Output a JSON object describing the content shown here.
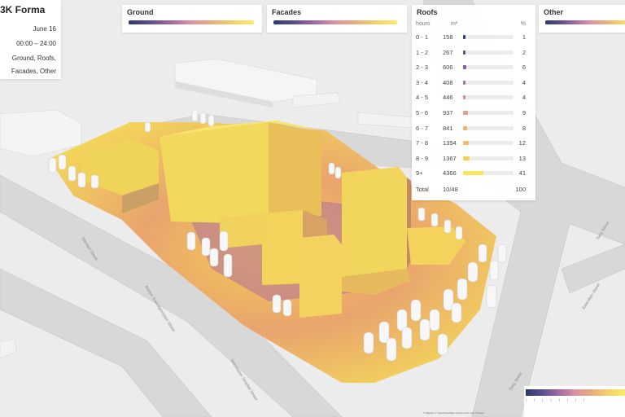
{
  "app": {
    "title": "3K Forma"
  },
  "info": {
    "date": "June 16",
    "time": "00:00 – 24:00",
    "surfaces_line1": "Ground, Roofs,",
    "surfaces_line2": "Facades, Other"
  },
  "legends": [
    {
      "title": "Ground"
    },
    {
      "title": "Facades"
    },
    {
      "title": "Other"
    }
  ],
  "roofs": {
    "title": "Roofs",
    "col_hours": "hours",
    "col_area": "m²",
    "col_pct": "%",
    "rows": [
      {
        "hours": "0 - 1",
        "area": "158",
        "pct": "1",
        "fraction": 0.01,
        "color": "#2d3a6b"
      },
      {
        "hours": "1 - 2",
        "area": "267",
        "pct": "2",
        "fraction": 0.02,
        "color": "#5b4e8a"
      },
      {
        "hours": "2 - 3",
        "area": "606",
        "pct": "6",
        "fraction": 0.06,
        "color": "#8a5e9a"
      },
      {
        "hours": "3 - 4",
        "area": "408",
        "pct": "4",
        "fraction": 0.04,
        "color": "#b06f9c"
      },
      {
        "hours": "4 - 5",
        "area": "446",
        "pct": "4",
        "fraction": 0.04,
        "color": "#d08a98"
      },
      {
        "hours": "5 - 6",
        "area": "937",
        "pct": "9",
        "fraction": 0.09,
        "color": "#e2a07e"
      },
      {
        "hours": "6 - 7",
        "area": "841",
        "pct": "8",
        "fraction": 0.08,
        "color": "#e9b46e"
      },
      {
        "hours": "7 - 8",
        "area": "1354",
        "pct": "12",
        "fraction": 0.12,
        "color": "#eec064"
      },
      {
        "hours": "8 - 9",
        "area": "1367",
        "pct": "13",
        "fraction": 0.13,
        "color": "#f3cf5e"
      },
      {
        "hours": "9+",
        "area": "4366",
        "pct": "41",
        "fraction": 0.41,
        "color": "#f8e55e"
      }
    ],
    "total_label": "Total",
    "total_area": "10/48",
    "total_pct": "100"
  },
  "map_labels": {
    "street1": "Stensen Street",
    "street2": "Robert Sveinbjornsson Street",
    "street3": "Stockhamn Stradtet Street",
    "street4": "Tang Street",
    "street5": "Eideviken Street",
    "street6": "Tang Street"
  },
  "attribution": "© Mapbox © OpenStreetMap Improve this map © Maxar"
}
